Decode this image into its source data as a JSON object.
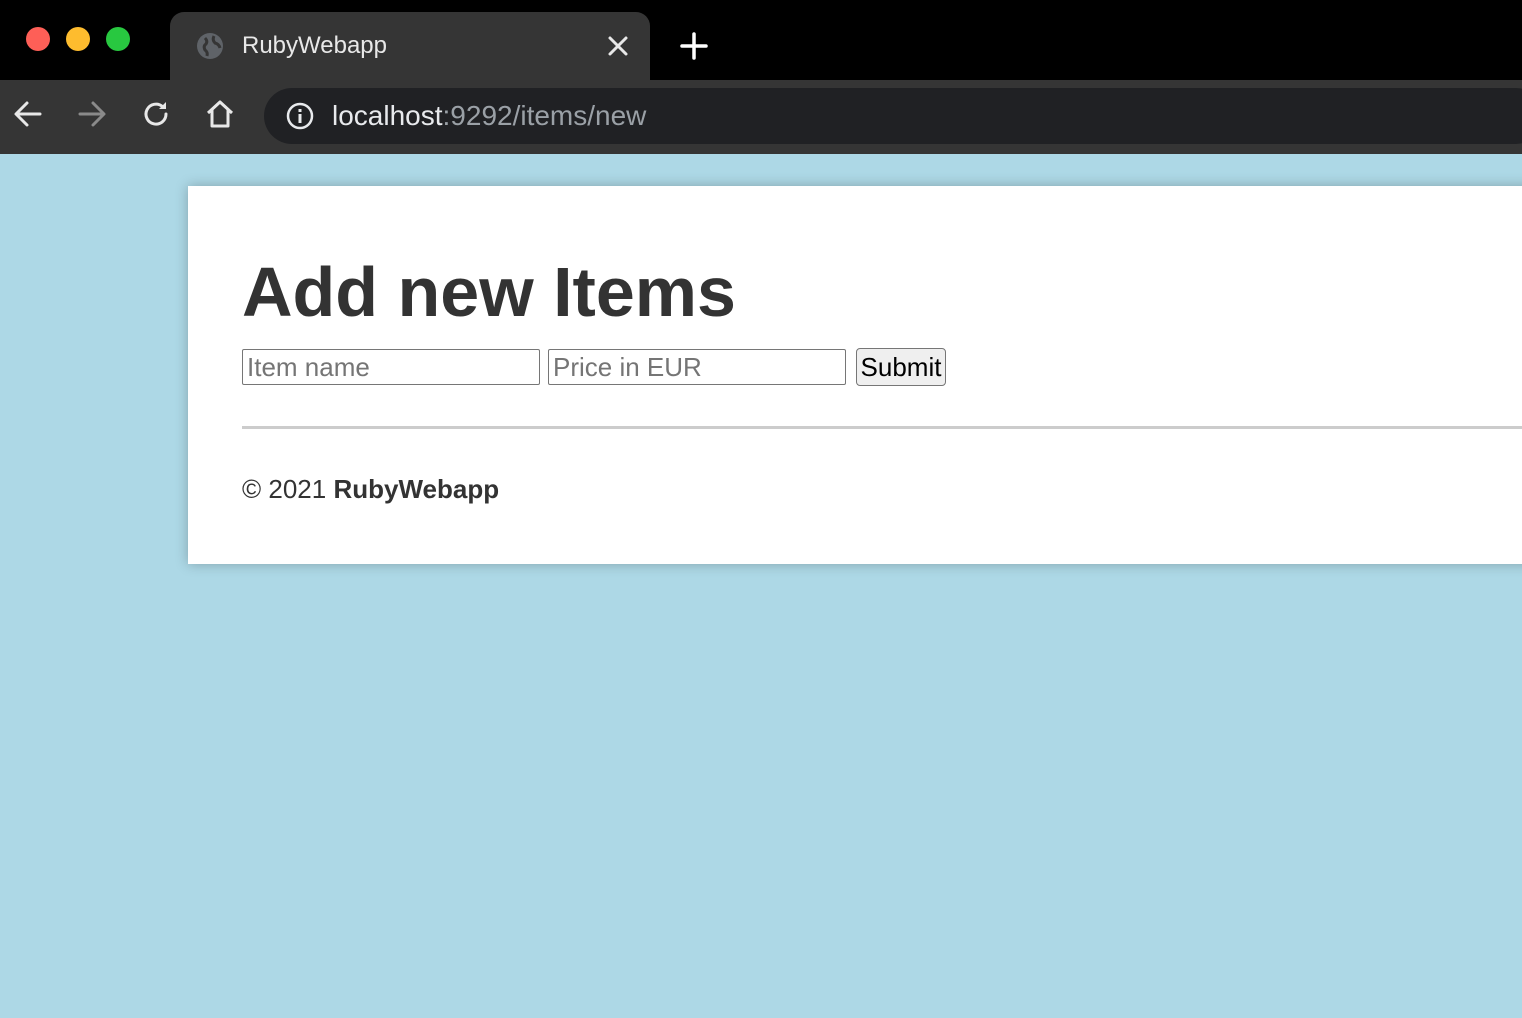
{
  "browser": {
    "tab": {
      "title": "RubyWebapp",
      "favicon": "globe-icon",
      "close_icon": "close-icon"
    },
    "new_tab_icon": "plus-icon",
    "nav": {
      "back_icon": "arrow-left-icon",
      "forward_icon": "arrow-right-icon",
      "reload_icon": "reload-icon",
      "home_icon": "home-icon"
    },
    "address_bar": {
      "info_icon": "info-icon",
      "host": "localhost",
      "rest": ":9292/items/new"
    }
  },
  "page": {
    "title": "Add new Items",
    "form": {
      "name_placeholder": "Item name",
      "name_value": "",
      "price_placeholder": "Price in EUR",
      "price_value": "",
      "submit_label": "Submit"
    },
    "footer": {
      "copyright": "© 2021",
      "brand": "RubyWebapp"
    }
  },
  "colors": {
    "page_background": "#add8e6",
    "card_background": "#ffffff",
    "text": "#333333",
    "chrome_dark": "#000000",
    "chrome_toolbar": "#353535",
    "omnibox": "#202124"
  }
}
